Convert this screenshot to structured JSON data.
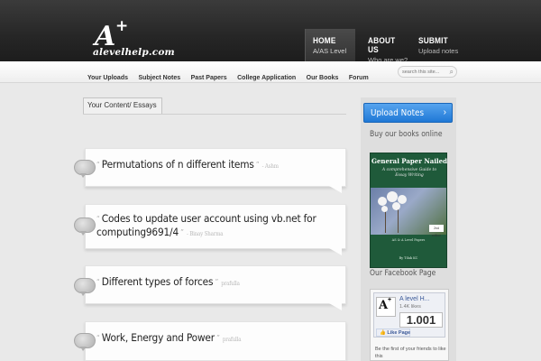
{
  "header": {
    "logo_letter": "A",
    "logo_plus": "+",
    "logo_text": "alevelhelp.com",
    "nav": [
      {
        "label": "HOME",
        "sub": "A/AS Level"
      },
      {
        "label": "ABOUT US",
        "sub": "Who are we?"
      },
      {
        "label": "SUBMIT",
        "sub": "Upload notes"
      }
    ]
  },
  "subnav": {
    "items": [
      "Your Uploads",
      "Subject Notes",
      "Past Papers",
      "College Application",
      "Our Books",
      "Forum"
    ],
    "search_placeholder": "search this site..."
  },
  "content": {
    "tab_label": "Your Content/ Essays",
    "posts": [
      {
        "title": "Permutations of n different items",
        "author": "- Ashm"
      },
      {
        "title_line1": "Codes to update user account using vb.net for",
        "title_line2": "computing9691/4",
        "author": "- Binay Sharma"
      },
      {
        "title": "Different types of forces",
        "author": "prafulla"
      },
      {
        "title": "Work, Energy and Power",
        "author": "prafulla"
      }
    ]
  },
  "sidebar": {
    "upload_label": "Upload Notes",
    "books_heading": "Buy our books online",
    "book": {
      "title": "General Paper Nailed",
      "subtitle": "A comprehensive Guide to Essay Writing",
      "badge": "2nd edition",
      "foot": "AS & A Level Papers",
      "author": "By Tilak KC"
    },
    "facebook_heading": "Our Facebook Page",
    "facebook": {
      "page_name": "A level H...",
      "likes": "1.4K likes",
      "count": "1.001",
      "like_button": "Like Page",
      "first_text": "Be the first of your friends to like this"
    }
  }
}
